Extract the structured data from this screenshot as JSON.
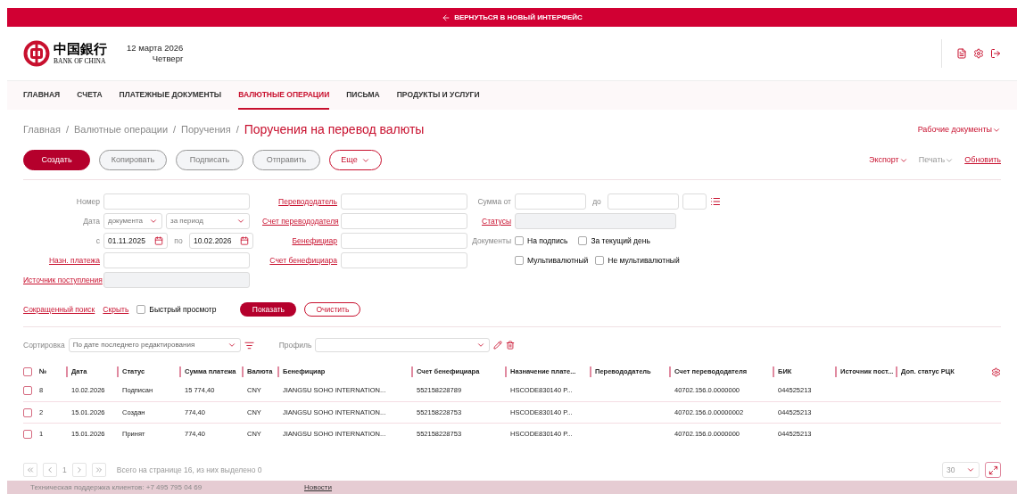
{
  "top_bar": {
    "label": "ВЕРНУТЬСЯ В НОВЫЙ ИНТЕРФЕЙС"
  },
  "header": {
    "logo_chinese": "中国銀行",
    "logo_latin": "BANK OF CHINA",
    "date": "12 марта 2026",
    "weekday": "Четверг"
  },
  "nav": [
    {
      "label": "ГЛАВНАЯ",
      "selected": false
    },
    {
      "label": "СЧЕТА",
      "selected": false
    },
    {
      "label": "ПЛАТЕЖНЫЕ ДОКУМЕНТЫ",
      "selected": false
    },
    {
      "label": "ВАЛЮТНЫЕ ОПЕРАЦИИ",
      "selected": true
    },
    {
      "label": "ПИСЬМА",
      "selected": false
    },
    {
      "label": "ПРОДУКТЫ И УСЛУГИ",
      "selected": false
    }
  ],
  "breadcrumb": [
    {
      "label": "Главная",
      "separator": "/"
    },
    {
      "label": "Валютные операции",
      "separator": "/"
    },
    {
      "label": "Поручения",
      "separator": "/"
    }
  ],
  "page_title": "Поручения на перевод валюты",
  "working_documents": "Рабочие документы",
  "actions": [
    {
      "label": "Создать",
      "kind": "primary"
    },
    {
      "label": "Копировать",
      "kind": "secondary"
    },
    {
      "label": "Подписать",
      "kind": "secondary"
    },
    {
      "label": "Отправить",
      "kind": "secondary"
    },
    {
      "label": "Еще",
      "kind": "menu"
    }
  ],
  "tools": [
    {
      "label": "Экспорт",
      "kind": "menu",
      "disabled": false
    },
    {
      "label": "Печать",
      "kind": "menu",
      "disabled": true
    },
    {
      "label": "Обновить",
      "kind": "link",
      "disabled": false
    }
  ],
  "filters": {
    "number": {
      "label": "Номер"
    },
    "date": {
      "label": "Дата",
      "type": "документа",
      "period": "за период"
    },
    "from": {
      "label": "с",
      "value": "01.11.2025"
    },
    "to": {
      "label": "по",
      "value": "10.02.2026"
    },
    "purpose": {
      "label": "Назн. платежа"
    },
    "source": {
      "label": "Источник поступления",
      "disabled": true
    },
    "payer": {
      "label": "Перевододатель"
    },
    "payer_account": {
      "label": "Счет перевододателя"
    },
    "beneficiary": {
      "label": "Бенефициар"
    },
    "beneficiary_account": {
      "label": "Счет бенефициара"
    },
    "sum_from": {
      "label": "Сумма от"
    },
    "sum_to": {
      "label": "до"
    },
    "statuses": {
      "label": "Статусы",
      "disabled": true
    },
    "documents": {
      "label": "Документы",
      "options": [
        {
          "label": "На подпись",
          "checked": false
        },
        {
          "label": "За текущий день",
          "checked": false
        }
      ]
    },
    "currency_options": [
      {
        "label": "Мультивалютный",
        "checked": false
      },
      {
        "label": "Не мультивалютный",
        "checked": false
      }
    ]
  },
  "search_bar": {
    "links": [
      "Сокращенный поиск",
      "Скрыть"
    ],
    "quick_view": {
      "label": "Быстрый просмотр",
      "checked": false
    },
    "show": "Показать",
    "clear": "Очистить"
  },
  "sort": {
    "label": "Сортировка",
    "value": "По дате последнего редактирования"
  },
  "profile": {
    "label": "Профиль"
  },
  "table": {
    "all_checked": false,
    "columns": [
      "№",
      "Дата",
      "Статус",
      "Сумма платежа",
      "Валюта",
      "Бенефициар",
      "Счет бенефициара",
      "Назначение плате...",
      "Перевододатель",
      "Счет перевододателя",
      "БИК",
      "Источник пост...",
      "Доп. статус РЦК"
    ],
    "rows": [
      {
        "selected": false,
        "cells": [
          "8",
          "10.02.2026",
          "Подписан",
          "15 774,40",
          "CNY",
          "JIANGSU SOHO INTERNATION...",
          "552158228789",
          "HSCODE830140 P...",
          "",
          "40702.156.0.0000000",
          "044525213",
          "",
          ""
        ]
      },
      {
        "selected": false,
        "cells": [
          "2",
          "15.01.2026",
          "Создан",
          "774,40",
          "CNY",
          "JIANGSU SOHO INTERNATION...",
          "552158228753",
          "HSCODE830140 P...",
          "",
          "40702.156.0.00000002",
          "044525213",
          "",
          ""
        ]
      },
      {
        "selected": false,
        "cells": [
          "1",
          "15.01.2026",
          "Принят",
          "774,40",
          "CNY",
          "JIANGSU SOHO INTERNATION...",
          "552158228753",
          "HSCODE830140 P...",
          "",
          "40702.156.0.0000000",
          "044525213",
          "",
          ""
        ]
      }
    ]
  },
  "pagination": {
    "page": "1",
    "summary": "Всего на странице 16, из них выделено 0",
    "page_size": "30"
  },
  "footer": {
    "support": "Техническая поддержка клиентов: +7 495 795 04 69",
    "news": "Новости"
  }
}
